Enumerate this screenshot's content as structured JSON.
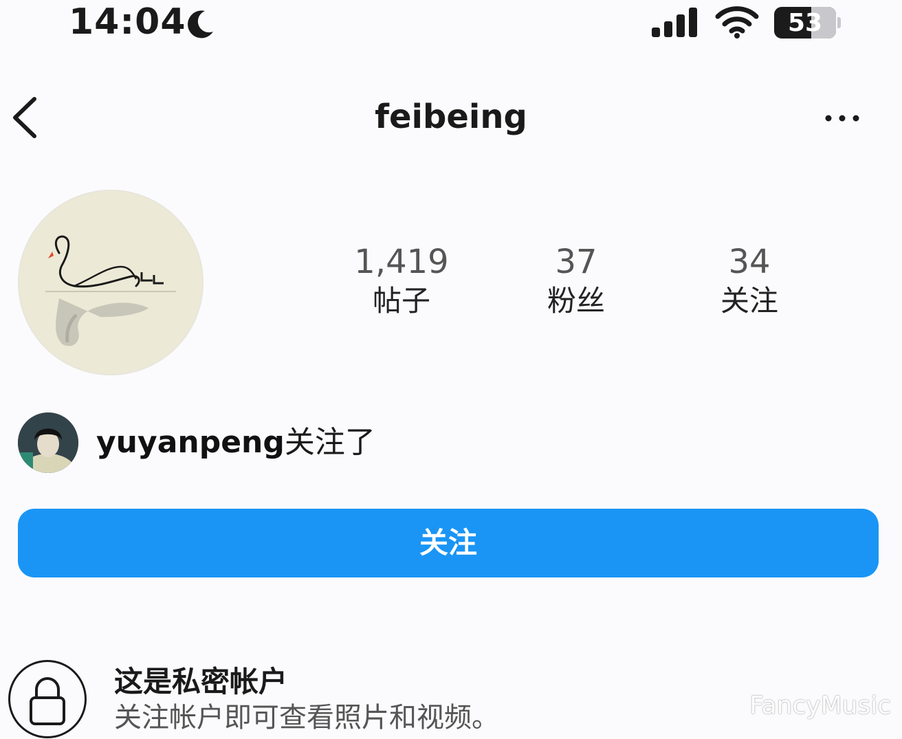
{
  "status_bar": {
    "time": "14:04",
    "battery": "53",
    "icons": [
      "moon-icon",
      "cellular-signal-icon",
      "wifi-icon",
      "battery-icon"
    ]
  },
  "nav": {
    "username": "feibeing",
    "back_icon": "chevron-left-icon",
    "more_icon": "more-horizontal-icon"
  },
  "profile": {
    "avatar": "swan-avatar",
    "stats": [
      {
        "value": "1,419",
        "label": "帖子"
      },
      {
        "value": "37",
        "label": "粉丝"
      },
      {
        "value": "34",
        "label": "关注"
      }
    ]
  },
  "followed_by": {
    "username": "yuyanpeng",
    "suffix": "关注了"
  },
  "follow_button": {
    "label": "关注",
    "color": "#1a95f5"
  },
  "private_notice": {
    "icon": "lock-icon",
    "title": "这是私密帐户",
    "description": "关注帐户即可查看照片和视频。"
  },
  "watermark": "FancyMusic"
}
